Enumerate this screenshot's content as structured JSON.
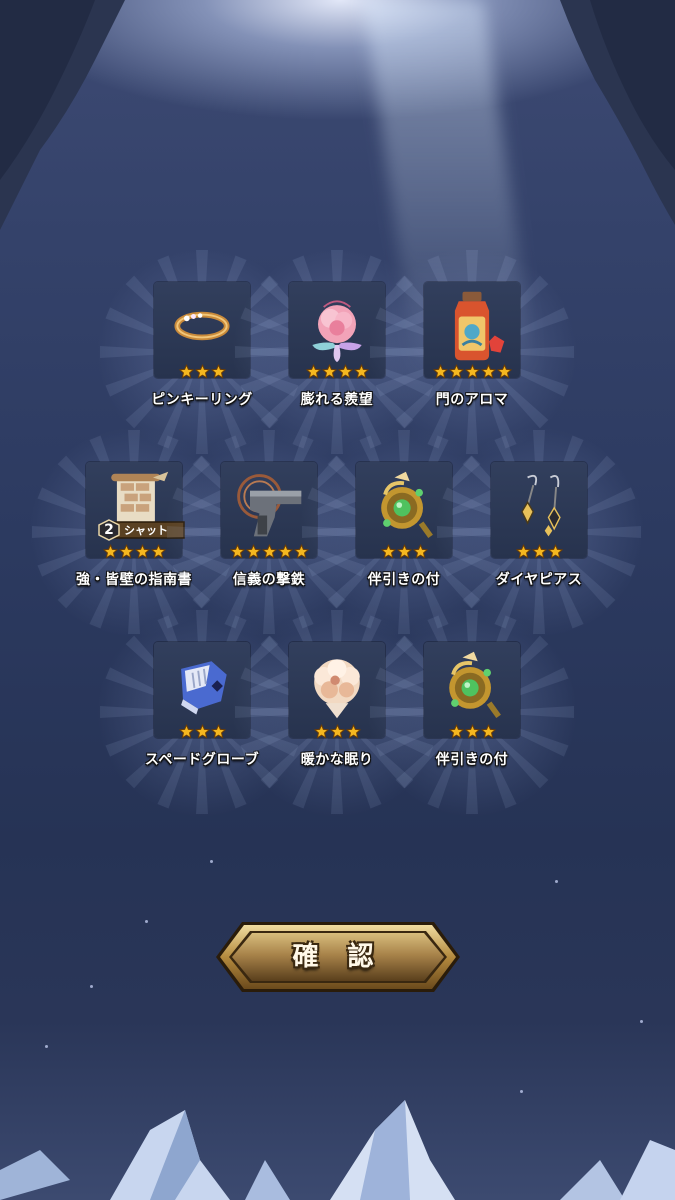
{
  "items": [
    {
      "name": "ピンキーリング",
      "stars": 3,
      "icon": "gold-ring-icon"
    },
    {
      "name": "膨れる羨望",
      "stars": 4,
      "icon": "pink-flower-icon"
    },
    {
      "name": "門のアロマ",
      "stars": 5,
      "icon": "aroma-bottle-icon"
    },
    {
      "name": "強・皆壁の指南書",
      "stars": 4,
      "icon": "scroll-icon",
      "quantity": "2",
      "quantity_label": "シャット"
    },
    {
      "name": "信義の撃鉄",
      "stars": 5,
      "icon": "pistol-icon"
    },
    {
      "name": "伴引きの付",
      "stars": 3,
      "icon": "green-gem-orb-icon"
    },
    {
      "name": "ダイヤピアス",
      "stars": 3,
      "icon": "diamond-earrings-icon"
    },
    {
      "name": "スペードグローブ",
      "stars": 3,
      "icon": "glove-icon"
    },
    {
      "name": "暖かな眠り",
      "stars": 3,
      "icon": "fluffy-pillow-icon"
    },
    {
      "name": "伴引きの付",
      "stars": 3,
      "icon": "green-gem-orb-icon"
    }
  ],
  "confirm_button": {
    "label": "確 認"
  },
  "colors": {
    "star": "#f5b820",
    "button_gold": "#c9a55a",
    "button_dark": "#3a2a12",
    "background": "#2a3658"
  }
}
